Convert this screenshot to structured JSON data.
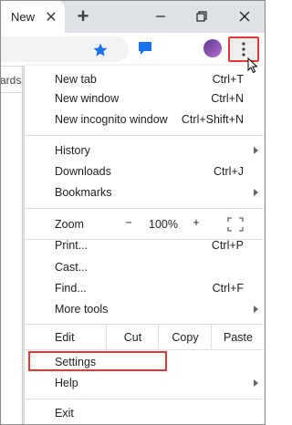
{
  "tab": {
    "title": "New",
    "close_glyph": "✕",
    "new_tab_glyph": "+"
  },
  "window_controls": {
    "minimize": "—",
    "restore": "❐",
    "close": "✕"
  },
  "toolbar": {
    "menu_glyph": "⋮"
  },
  "page": {
    "partial_text": "ards"
  },
  "menu": {
    "group1": [
      {
        "label": "New tab",
        "shortcut": "Ctrl+T"
      },
      {
        "label": "New window",
        "shortcut": "Ctrl+N"
      },
      {
        "label": "New incognito window",
        "shortcut": "Ctrl+Shift+N"
      }
    ],
    "group2": [
      {
        "label": "History",
        "shortcut": ""
      },
      {
        "label": "Downloads",
        "shortcut": "Ctrl+J"
      },
      {
        "label": "Bookmarks",
        "shortcut": ""
      }
    ],
    "zoom": {
      "label": "Zoom",
      "minus": "−",
      "value": "100%",
      "plus": "+"
    },
    "group3": [
      {
        "label": "Print...",
        "shortcut": "Ctrl+P"
      },
      {
        "label": "Cast...",
        "shortcut": ""
      },
      {
        "label": "Find...",
        "shortcut": "Ctrl+F"
      },
      {
        "label": "More tools",
        "shortcut": ""
      }
    ],
    "edit": {
      "label": "Edit",
      "cut": "Cut",
      "copy": "Copy",
      "paste": "Paste"
    },
    "group4": [
      {
        "label": "Settings"
      },
      {
        "label": "Help"
      }
    ],
    "exit": {
      "label": "Exit"
    }
  },
  "colors": {
    "highlight": "#e53935",
    "star": "#1a73e8",
    "chat": "#1a73e8"
  }
}
